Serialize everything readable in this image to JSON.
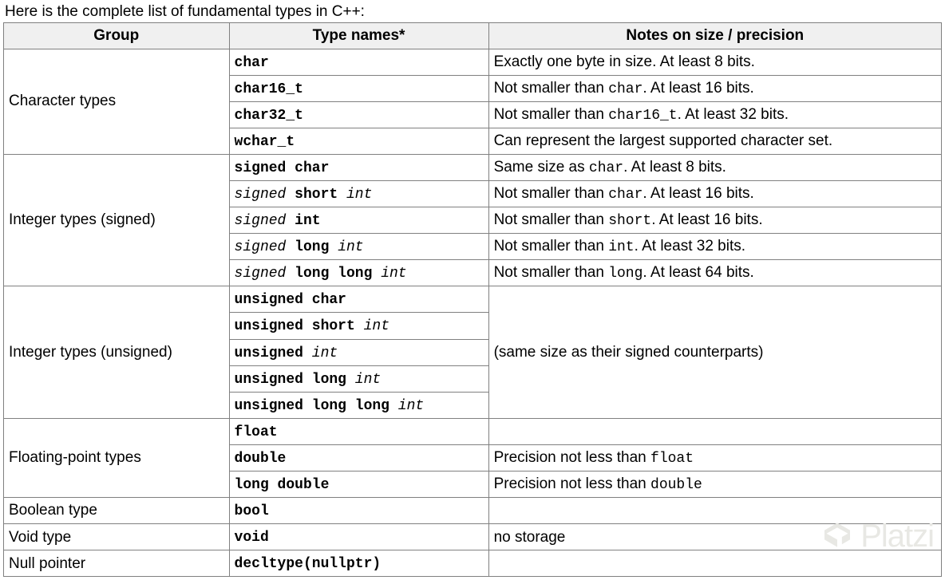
{
  "intro": "Here is the complete list of fundamental types in C++:",
  "headers": {
    "group": "Group",
    "type_names": "Type names*",
    "notes": "Notes on size / precision"
  },
  "groups": [
    {
      "label": "Character types",
      "rows": [
        {
          "type": [
            {
              "t": "char",
              "b": true
            }
          ],
          "note": [
            {
              "t": "Exactly one byte in size. At least 8 bits."
            }
          ]
        },
        {
          "type": [
            {
              "t": "char16_t",
              "b": true
            }
          ],
          "note": [
            {
              "t": "Not smaller than "
            },
            {
              "t": "char",
              "m": true
            },
            {
              "t": ". At least 16 bits."
            }
          ]
        },
        {
          "type": [
            {
              "t": "char32_t",
              "b": true
            }
          ],
          "note": [
            {
              "t": "Not smaller than "
            },
            {
              "t": "char16_t",
              "m": true
            },
            {
              "t": ". At least 32 bits."
            }
          ]
        },
        {
          "type": [
            {
              "t": "wchar_t",
              "b": true
            }
          ],
          "note": [
            {
              "t": "Can represent the largest supported character set."
            }
          ]
        }
      ]
    },
    {
      "label": "Integer types (signed)",
      "rows": [
        {
          "type": [
            {
              "t": "signed char",
              "b": true
            }
          ],
          "note": [
            {
              "t": "Same size as "
            },
            {
              "t": "char",
              "m": true
            },
            {
              "t": ". At least 8 bits."
            }
          ]
        },
        {
          "type": [
            {
              "t": "signed",
              "i": true
            },
            {
              "t": " "
            },
            {
              "t": "short",
              "b": true
            },
            {
              "t": " "
            },
            {
              "t": "int",
              "i": true
            }
          ],
          "note": [
            {
              "t": "Not smaller than "
            },
            {
              "t": "char",
              "m": true
            },
            {
              "t": ". At least 16 bits."
            }
          ]
        },
        {
          "type": [
            {
              "t": "signed",
              "i": true
            },
            {
              "t": " "
            },
            {
              "t": "int",
              "b": true
            }
          ],
          "note": [
            {
              "t": "Not smaller than "
            },
            {
              "t": "short",
              "m": true
            },
            {
              "t": ". At least 16 bits."
            }
          ]
        },
        {
          "type": [
            {
              "t": "signed",
              "i": true
            },
            {
              "t": " "
            },
            {
              "t": "long",
              "b": true
            },
            {
              "t": " "
            },
            {
              "t": "int",
              "i": true
            }
          ],
          "note": [
            {
              "t": "Not smaller than "
            },
            {
              "t": "int",
              "m": true
            },
            {
              "t": ". At least 32 bits."
            }
          ]
        },
        {
          "type": [
            {
              "t": "signed",
              "i": true
            },
            {
              "t": " "
            },
            {
              "t": "long long",
              "b": true
            },
            {
              "t": " "
            },
            {
              "t": "int",
              "i": true
            }
          ],
          "note": [
            {
              "t": "Not smaller than "
            },
            {
              "t": "long",
              "m": true
            },
            {
              "t": ". At least 64 bits."
            }
          ]
        }
      ]
    },
    {
      "label": "Integer types (unsigned)",
      "merged_note": "(same size as their signed counterparts)",
      "rows": [
        {
          "type": [
            {
              "t": "unsigned char",
              "b": true
            }
          ]
        },
        {
          "type": [
            {
              "t": "unsigned short",
              "b": true
            },
            {
              "t": " "
            },
            {
              "t": "int",
              "i": true
            }
          ]
        },
        {
          "type": [
            {
              "t": "unsigned",
              "b": true
            },
            {
              "t": " "
            },
            {
              "t": "int",
              "i": true
            }
          ]
        },
        {
          "type": [
            {
              "t": "unsigned long",
              "b": true
            },
            {
              "t": " "
            },
            {
              "t": "int",
              "i": true
            }
          ]
        },
        {
          "type": [
            {
              "t": "unsigned long long",
              "b": true
            },
            {
              "t": " "
            },
            {
              "t": "int",
              "i": true
            }
          ]
        }
      ]
    },
    {
      "label": "Floating-point types",
      "rows": [
        {
          "type": [
            {
              "t": "float",
              "b": true
            }
          ],
          "note": [
            {
              "t": ""
            }
          ]
        },
        {
          "type": [
            {
              "t": "double",
              "b": true
            }
          ],
          "note": [
            {
              "t": "Precision not less than "
            },
            {
              "t": "float",
              "m": true
            }
          ]
        },
        {
          "type": [
            {
              "t": "long double",
              "b": true
            }
          ],
          "note": [
            {
              "t": "Precision not less than "
            },
            {
              "t": "double",
              "m": true
            }
          ]
        }
      ]
    },
    {
      "label": "Boolean type",
      "rows": [
        {
          "type": [
            {
              "t": "bool",
              "b": true
            }
          ],
          "note": [
            {
              "t": ""
            }
          ]
        }
      ]
    },
    {
      "label": "Void type",
      "rows": [
        {
          "type": [
            {
              "t": "void",
              "b": true
            }
          ],
          "note": [
            {
              "t": "no storage"
            }
          ]
        }
      ]
    },
    {
      "label": "Null pointer",
      "rows": [
        {
          "type": [
            {
              "t": "decltype(nullptr)",
              "b": true
            }
          ],
          "note": [
            {
              "t": ""
            }
          ]
        }
      ]
    }
  ],
  "watermark": "Platzi"
}
